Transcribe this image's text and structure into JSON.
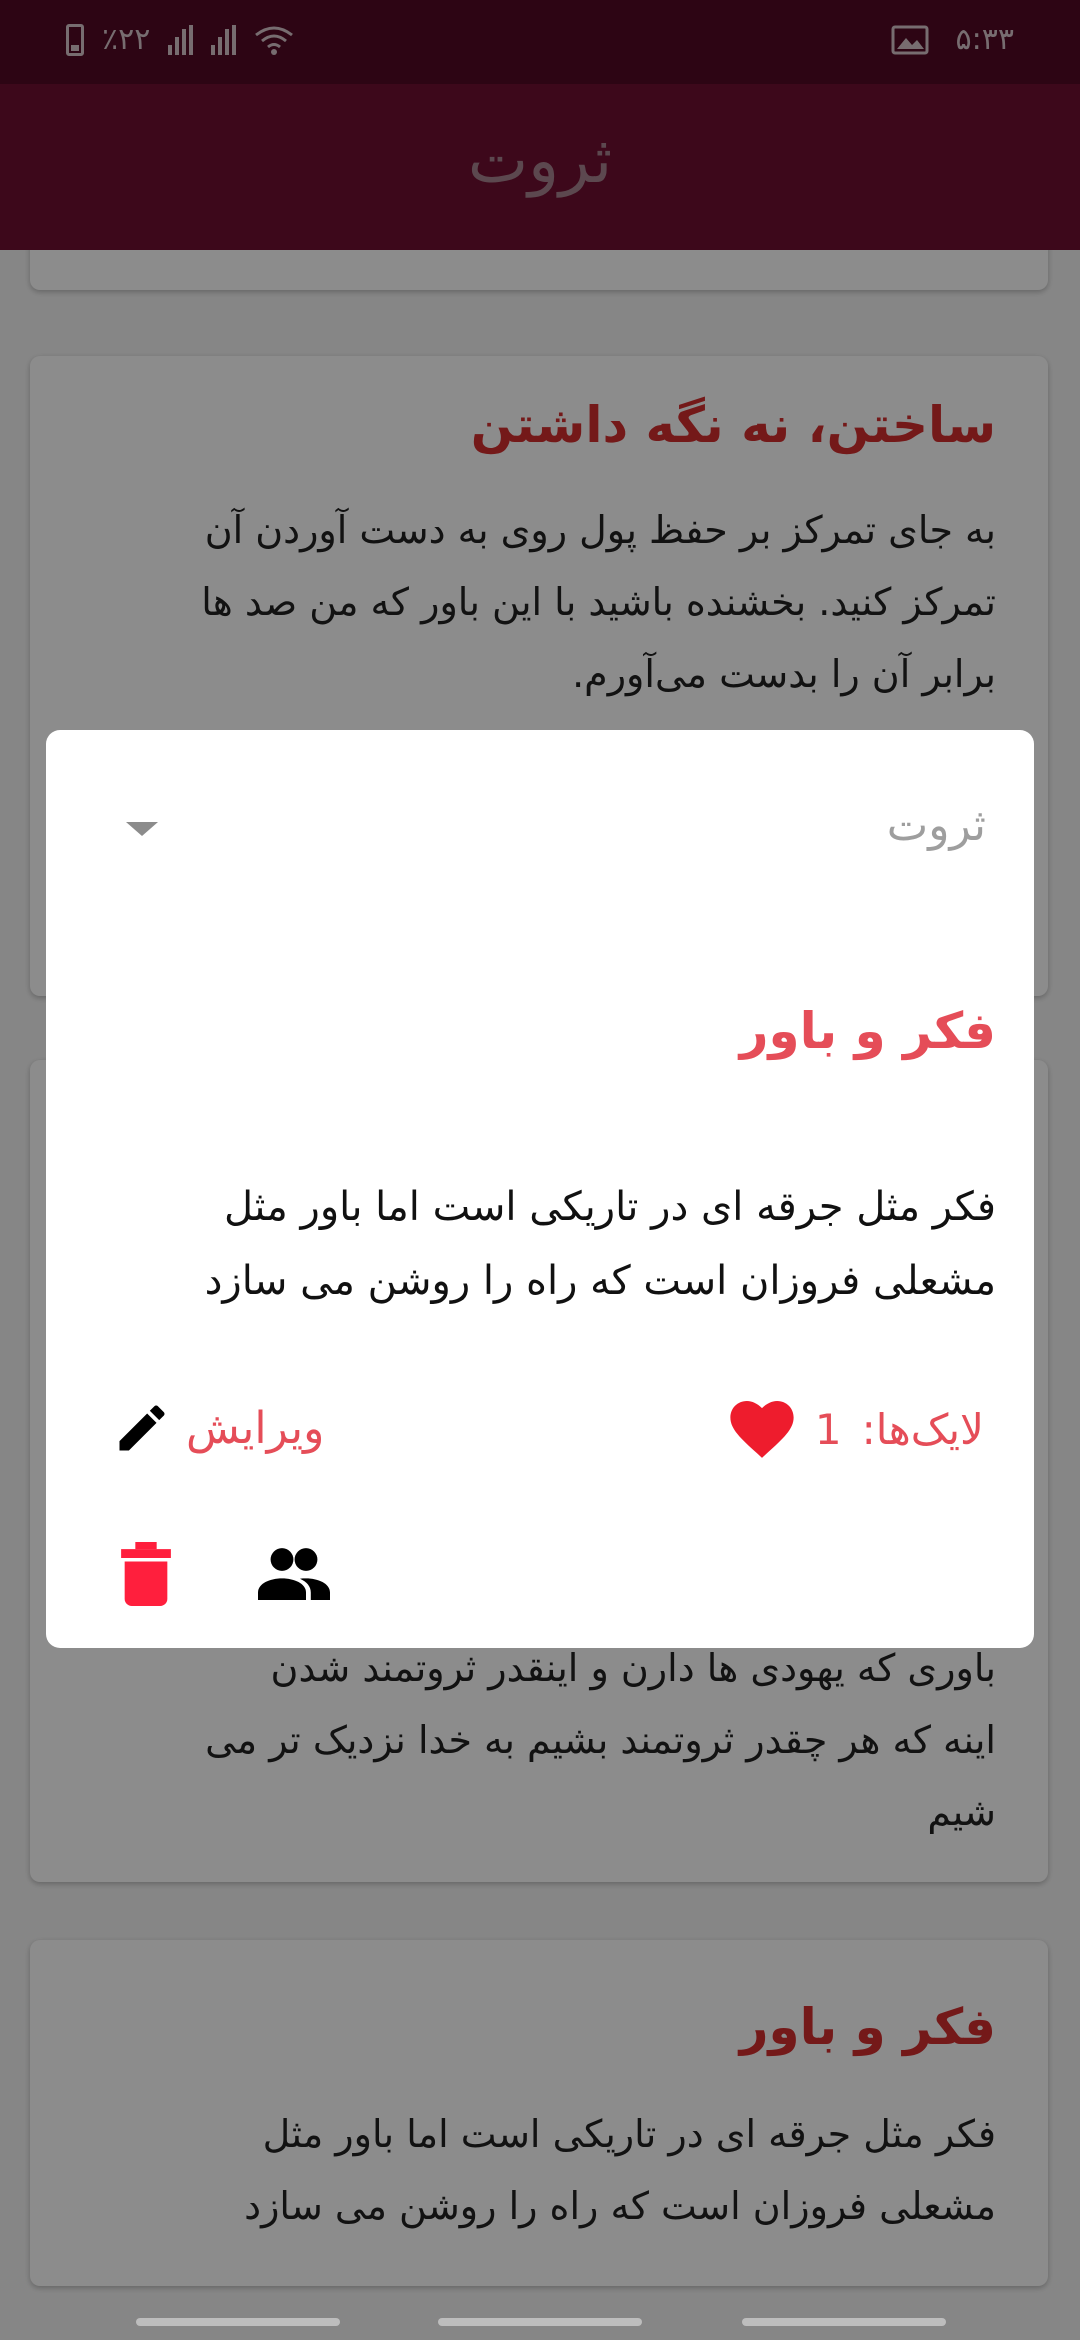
{
  "status_bar": {
    "battery_percent": "٪۲۲",
    "time": "۵:۳۳",
    "icons": [
      "battery-icon",
      "signal-icon",
      "signal-icon",
      "wifi-icon",
      "image-icon"
    ]
  },
  "app_bar": {
    "title": "ثروت"
  },
  "cards": [
    {
      "title": "ساختن، نه نگه داشتن",
      "body_lines": [
        "به جای تمرکز بر حفظ پول روی به دست آوردن آن",
        "تمرکز کنید. بخشنده باشید با این باور که من صد ها",
        "برابر آن را بدست می‌آورم."
      ]
    },
    {
      "title": "",
      "body_lines": [
        "باوری که یهودی ها دارن و اینقدر ثروتمند شدن",
        "اینه که هر چقدر ثروتمند بشیم به خدا نزدیک تر می",
        "شیم"
      ]
    },
    {
      "title": "فکر و باور",
      "body_lines": [
        "فکر مثل جرقه ای در تاریکی است اما باور مثل",
        "مشعلی فروزان است که راه را روشن می سازد"
      ]
    }
  ],
  "dialog": {
    "category_dropdown": {
      "value": "ثروت"
    },
    "title": "فکر و باور",
    "body_lines": [
      "فکر مثل جرقه ای در تاریکی است اما باور مثل",
      "مشعلی فروزان است که راه را روشن می سازد"
    ],
    "likes_label": "لایک‌ها:",
    "likes_count": "1",
    "edit_label": "ویرایش",
    "icons": [
      "heart-icon",
      "pencil-icon",
      "trash-icon",
      "people-icon"
    ]
  },
  "colors": {
    "status_bar": "#520a26",
    "app_bar": "#6f0f32",
    "accent_red": "#e54d58",
    "delete_red": "#ff1f3d"
  }
}
